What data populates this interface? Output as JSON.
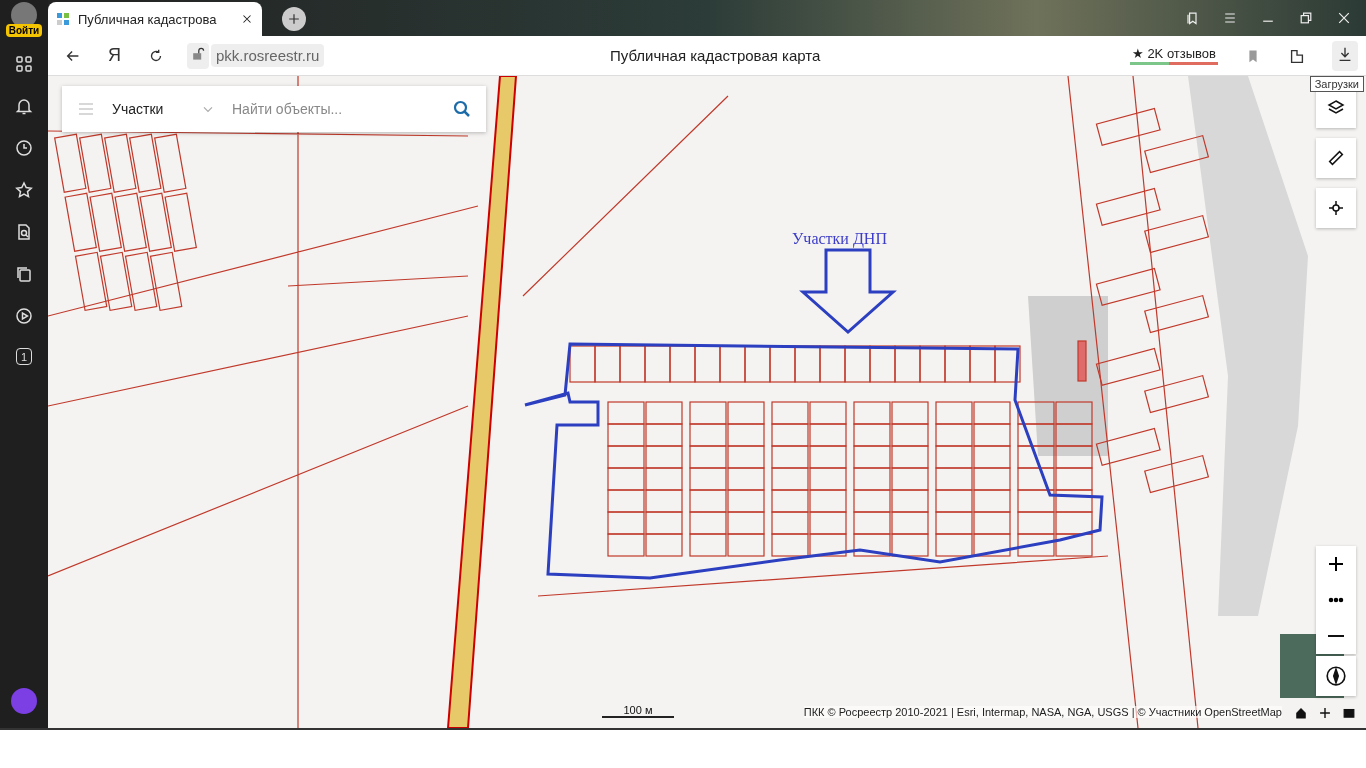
{
  "sidebar": {
    "login_label": "Войти",
    "counter_badge": "1"
  },
  "tab": {
    "title": "Публичная кадастрова",
    "selected": true
  },
  "address_bar": {
    "logo": "Я",
    "url": "pkk.rosreestr.ru",
    "page_title": "Публичная кадастровая карта",
    "reviews": "★ 2K отзывов",
    "tooltip": "Загрузки"
  },
  "map": {
    "search": {
      "category": "Участки",
      "placeholder": "Найти объекты..."
    },
    "annotation": "Участки ДНП",
    "scale": "100 м",
    "attribution": "ПКК © Росреестр 2010-2021 | Esri, Intermap, NASA, NGA, USGS | © Участники OpenStreetMap"
  }
}
